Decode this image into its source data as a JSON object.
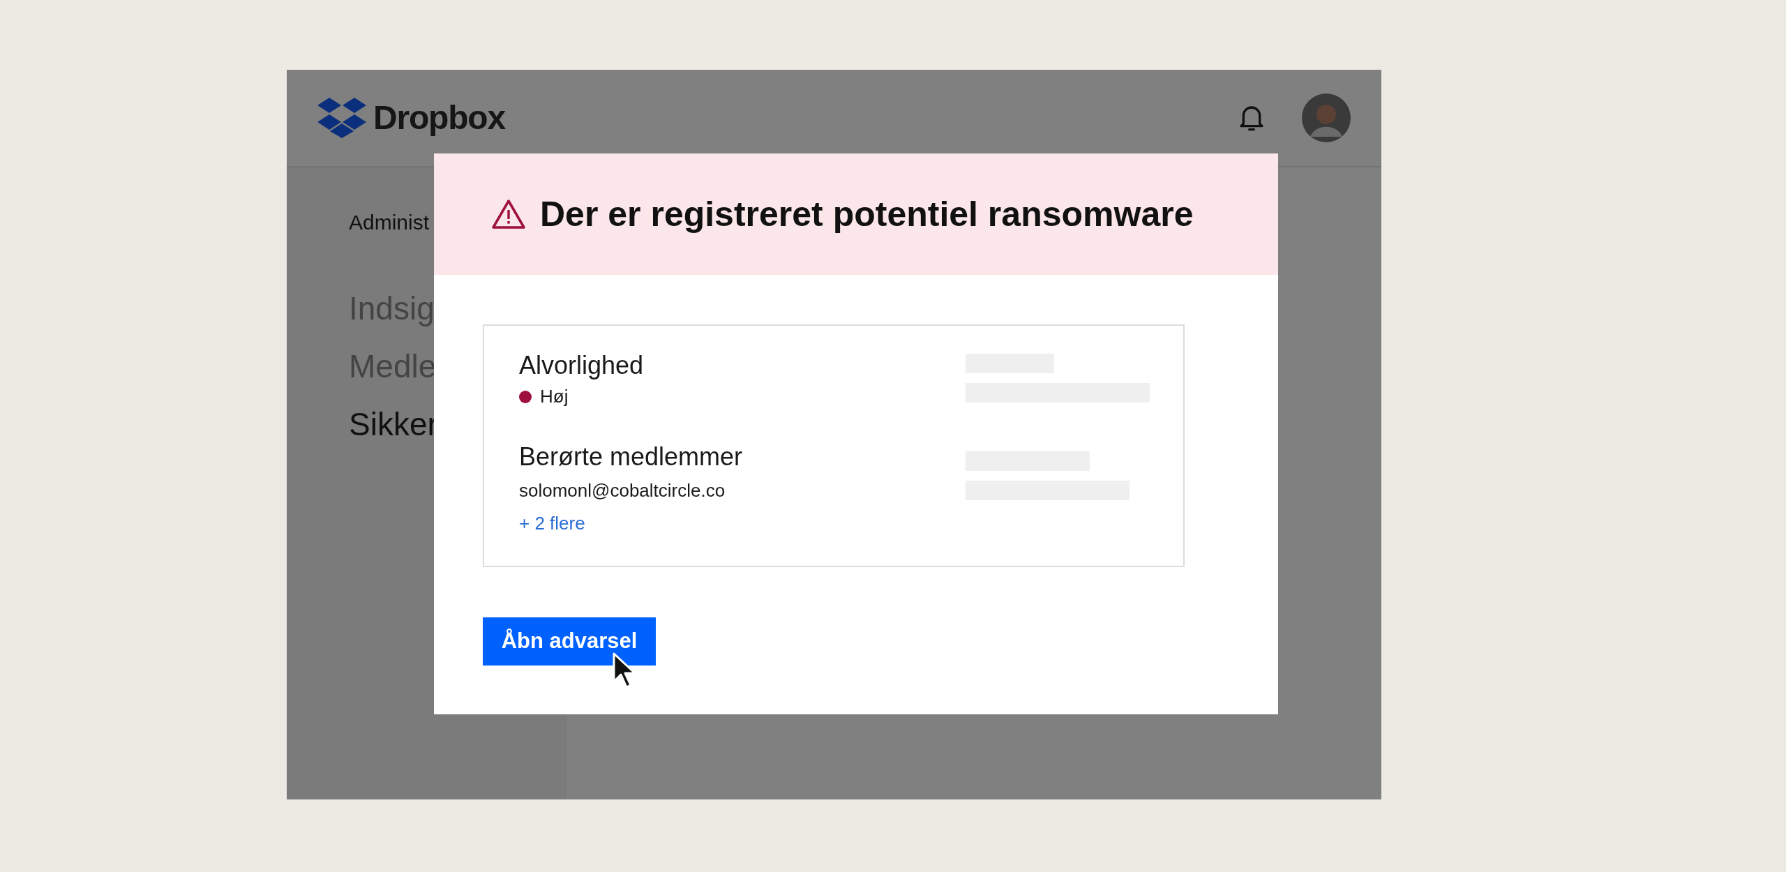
{
  "header": {
    "logo": "Dropbox"
  },
  "sidebar": {
    "heading": "Administ",
    "items": [
      {
        "label": "Indsig",
        "selected": false
      },
      {
        "label": "Medle",
        "selected": false
      },
      {
        "label": "Sikker",
        "selected": true
      }
    ]
  },
  "alert": {
    "title": "Der er registreret potentiel ransomware",
    "severity_label": "Alvorlighed",
    "severity": {
      "label": "Høj",
      "color": "#9e0f3d"
    },
    "members_label": "Berørte medlemmer",
    "member": "solomonl@cobaltcircle.co",
    "more_link": "+ 2 flere",
    "button": "Åbn advarsel"
  }
}
